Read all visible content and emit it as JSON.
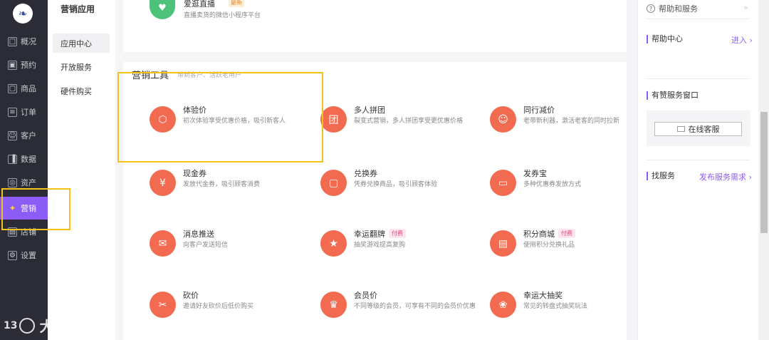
{
  "nav": {
    "logo": "❧",
    "items": [
      {
        "label": "概况",
        "icon": "monitor-icon",
        "glyph": "□"
      },
      {
        "label": "预约",
        "icon": "calendar-icon",
        "glyph": "▣"
      },
      {
        "label": "商品",
        "icon": "bag-icon",
        "glyph": "▢"
      },
      {
        "label": "订单",
        "icon": "order-icon",
        "glyph": "≡"
      },
      {
        "label": "客户",
        "icon": "user-icon",
        "glyph": "☺"
      },
      {
        "label": "数据",
        "icon": "chart-icon",
        "glyph": "▐"
      },
      {
        "label": "资产",
        "icon": "asset-icon",
        "glyph": "◎"
      },
      {
        "label": "营销",
        "icon": "marketing-icon",
        "glyph": "✦"
      },
      {
        "label": "店铺",
        "icon": "shop-icon",
        "glyph": "▤"
      },
      {
        "label": "设置",
        "icon": "settings-icon",
        "glyph": "⚙"
      }
    ]
  },
  "subnav": {
    "title": "营销应用",
    "items": [
      "应用中心",
      "开放服务",
      "硬件购买"
    ]
  },
  "top_app": {
    "name": "爱逛直播",
    "badge": "最新",
    "desc": "直播卖货的微信小程序平台",
    "glyph": "♥"
  },
  "section": {
    "title": "营销工具",
    "subtitle": "带新客户、活跃老用户"
  },
  "tools": [
    {
      "name": "体验价",
      "desc": "初次体验享受优惠价格，吸引新客人",
      "glyph": "⬡",
      "badge": ""
    },
    {
      "name": "多人拼团",
      "desc": "裂变式营销，多人拼团享受更优惠价格",
      "glyph": "团",
      "badge": ""
    },
    {
      "name": "同行减价",
      "desc": "老带新利器，激活老客的同时拉新",
      "glyph": "☺",
      "badge": ""
    },
    {
      "name": "现金券",
      "desc": "发放代金券，吸引顾客消费",
      "glyph": "¥",
      "badge": ""
    },
    {
      "name": "兑换券",
      "desc": "凭券兑换商品，吸引顾客体验",
      "glyph": "▢",
      "badge": ""
    },
    {
      "name": "发券宝",
      "desc": "多种优惠券发放方式",
      "glyph": "▭",
      "badge": ""
    },
    {
      "name": "消息推送",
      "desc": "向客户发送短信",
      "glyph": "✉",
      "badge": ""
    },
    {
      "name": "幸运翻牌",
      "desc": "抽奖游戏提高复购",
      "glyph": "★",
      "badge": "付费"
    },
    {
      "name": "积分商城",
      "desc": "使用积分兑换礼品",
      "glyph": "▤",
      "badge": "付费"
    },
    {
      "name": "砍价",
      "desc": "邀请好友砍价后低价购买",
      "glyph": "✂",
      "badge": ""
    },
    {
      "name": "会员价",
      "desc": "不同等级的会员，可享有不同的会员价优惠",
      "glyph": "♛",
      "badge": ""
    },
    {
      "name": "幸运大抽奖",
      "desc": "常见的转盘式抽奖玩法",
      "glyph": "❀",
      "badge": ""
    }
  ],
  "right_panel": {
    "help_label": "帮助和服务",
    "help_arrow": "»",
    "help_center": "帮助中心",
    "enter_link": "进入 ›",
    "service_window": "有赞服务窗口",
    "online_service": "在线客服",
    "find_service": "找服务",
    "publish_link": "发布服务需求 ›"
  },
  "watermark": {
    "num": "13",
    "text": "大数跨境"
  },
  "colors": {
    "accent": "#8b5cf6",
    "tool_icon": "#f26b50",
    "highlight": "#f5c21b",
    "sidebar": "#2b2c36"
  }
}
